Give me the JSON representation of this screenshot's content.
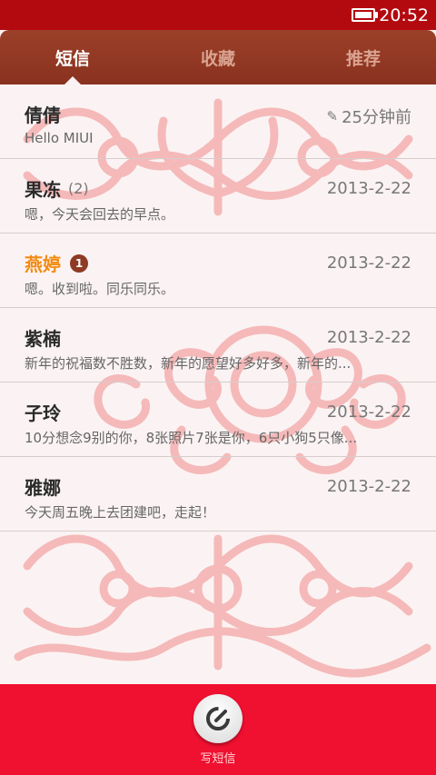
{
  "status_bar": {
    "time": "20:52"
  },
  "tabs": [
    {
      "label": "短信",
      "active": true
    },
    {
      "label": "收藏",
      "active": false
    },
    {
      "label": "推荐",
      "active": false
    }
  ],
  "conversations": [
    {
      "name": "倩倩",
      "date": "25分钟前",
      "preview": "Hello MIUI",
      "draft": true
    },
    {
      "name": "果冻",
      "count": "(2)",
      "date": "2013-2-22",
      "preview": "嗯，今天会回去的早点。"
    },
    {
      "name": "燕婷",
      "badge": "1",
      "unread": true,
      "date": "2013-2-22",
      "preview": "嗯。收到啦。同乐同乐。"
    },
    {
      "name": "紫楠",
      "date": "2013-2-22",
      "preview": "新年的祝福数不胜数，新年的愿望好多好多，新年的..."
    },
    {
      "name": "子玲",
      "date": "2013-2-22",
      "preview": "10分想念9别的你，8张照片7张是你，6只小狗5只像..."
    },
    {
      "name": "雅娜",
      "date": "2013-2-22",
      "preview": "今天周五晚上去团建吧，走起！"
    }
  ],
  "bottom_bar": {
    "compose_label": "写短信"
  },
  "colors": {
    "status_bar": "#b30a10",
    "tab_bar": "#9b3f28",
    "bottom_bar": "#f01030",
    "unread_name": "#f28b12",
    "badge": "#8f3a24"
  },
  "icons": {
    "battery": "battery-icon",
    "draft": "pencil-icon",
    "compose": "compose-icon"
  }
}
